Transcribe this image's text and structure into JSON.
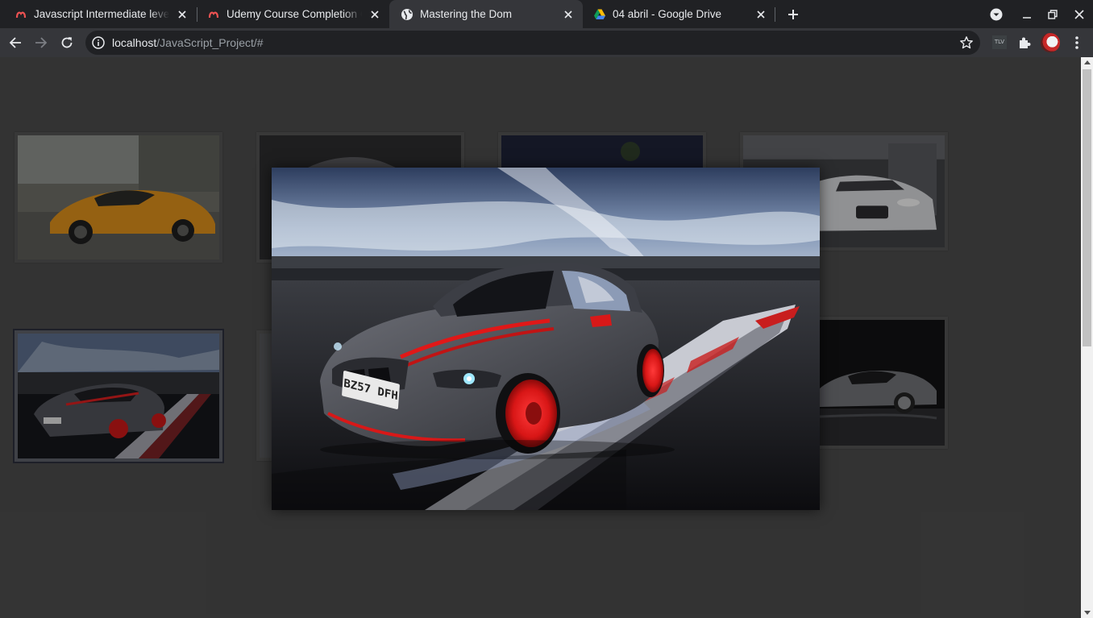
{
  "browser": {
    "tabs": [
      {
        "title": "Javascript Intermediate level",
        "icon": "udemy-icon",
        "active": false
      },
      {
        "title": "Udemy Course Completion Ce",
        "icon": "udemy-icon",
        "active": false
      },
      {
        "title": "Mastering the Dom",
        "icon": "globe-icon",
        "active": true
      },
      {
        "title": "04 abril - Google Drive",
        "icon": "google-drive-icon",
        "active": false
      }
    ],
    "address": {
      "host": "localhost",
      "path": "/JavaScript_Project/#"
    },
    "extension_label": "TLV"
  },
  "gallery": {
    "thumbnails": [
      {
        "subject": "orange supercar",
        "selected": false
      },
      {
        "subject": "dark sports car",
        "selected": false
      },
      {
        "subject": "car at night",
        "selected": false
      },
      {
        "subject": "white sports car in garage",
        "selected": false
      },
      {
        "subject": "grey BMW on race track",
        "selected": true
      },
      {
        "subject": "sports car",
        "selected": false
      },
      {
        "subject": "sports car",
        "selected": false
      },
      {
        "subject": "silver coupe",
        "selected": false
      }
    ],
    "lightbox": {
      "subject": "grey BMW on race track",
      "plate": "BZ57 DFH"
    }
  },
  "colors": {
    "page_bg": "#4a4a4a",
    "tab_bar": "#202124",
    "toolbar": "#35363a",
    "accent_red": "#e01818"
  }
}
